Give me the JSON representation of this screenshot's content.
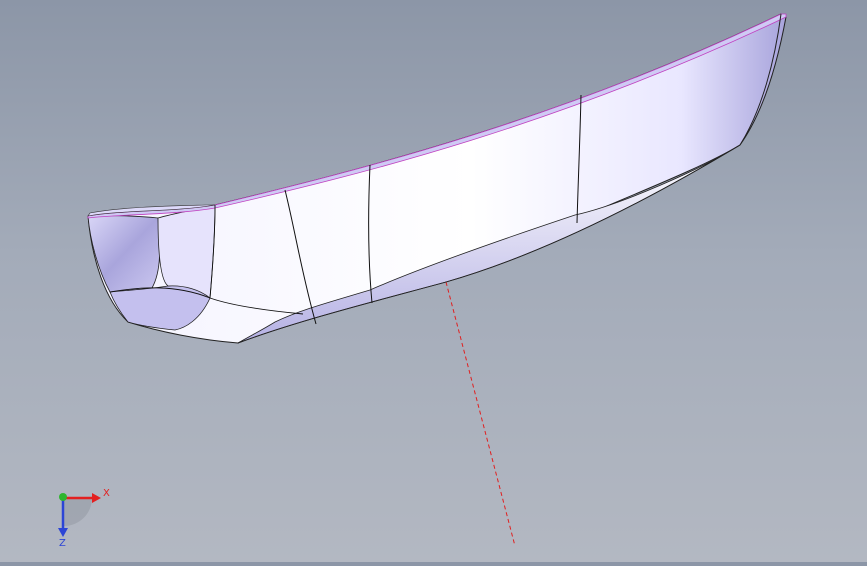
{
  "viewport": {
    "background_top": "#8c96a7",
    "background_bottom": "#b3b8c2"
  },
  "model": {
    "shape": "boat-hull",
    "surface_color": "#eceaff",
    "shade_color": "#9f9bd6",
    "edge_color": "#111111",
    "highlight_edge_color": "#c040c0"
  },
  "centerline": {
    "color": "#e02020",
    "style": "dashed"
  },
  "triad": {
    "x_label": "X",
    "z_label": "Z",
    "x_color": "#e32020",
    "y_color": "#2fb52f",
    "z_color": "#2c45d6"
  }
}
